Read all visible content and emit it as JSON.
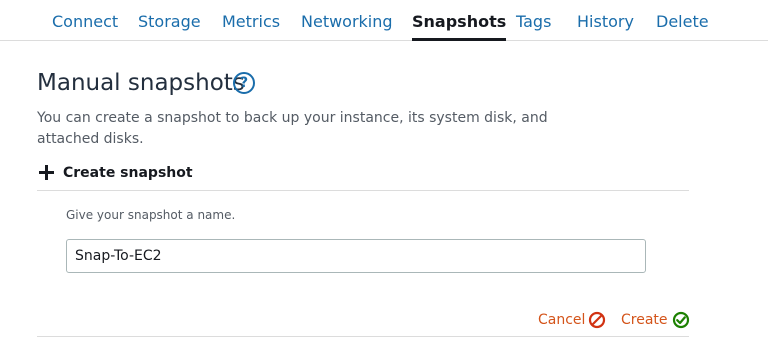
{
  "tabs": [
    {
      "label": "Connect",
      "active": false
    },
    {
      "label": "Storage",
      "active": false
    },
    {
      "label": "Metrics",
      "active": false
    },
    {
      "label": "Networking",
      "active": false
    },
    {
      "label": "Snapshots",
      "active": true
    },
    {
      "label": "Tags",
      "active": false
    },
    {
      "label": "History",
      "active": false
    },
    {
      "label": "Delete",
      "active": false
    }
  ],
  "section": {
    "title": "Manual snapshots",
    "help_icon": "?",
    "description": "You can create a snapshot to back up your instance, its system disk, and attached disks."
  },
  "create_snapshot": {
    "label": "Create snapshot",
    "icon": "plus-icon"
  },
  "form": {
    "name_label": "Give your snapshot a name.",
    "name_value": "Snap-To-EC2"
  },
  "actions": {
    "cancel_label": "Cancel",
    "cancel_icon": "cancel-circle-slash-icon",
    "create_label": "Create",
    "create_icon": "check-circle-icon"
  },
  "colors": {
    "link_blue": "#1a6dab",
    "action_orange": "#d4541a",
    "cancel_red": "#d13212",
    "create_green": "#1d8102",
    "text_dark": "#16191f",
    "text_muted": "#545b64",
    "divider": "#dcdcdc"
  }
}
